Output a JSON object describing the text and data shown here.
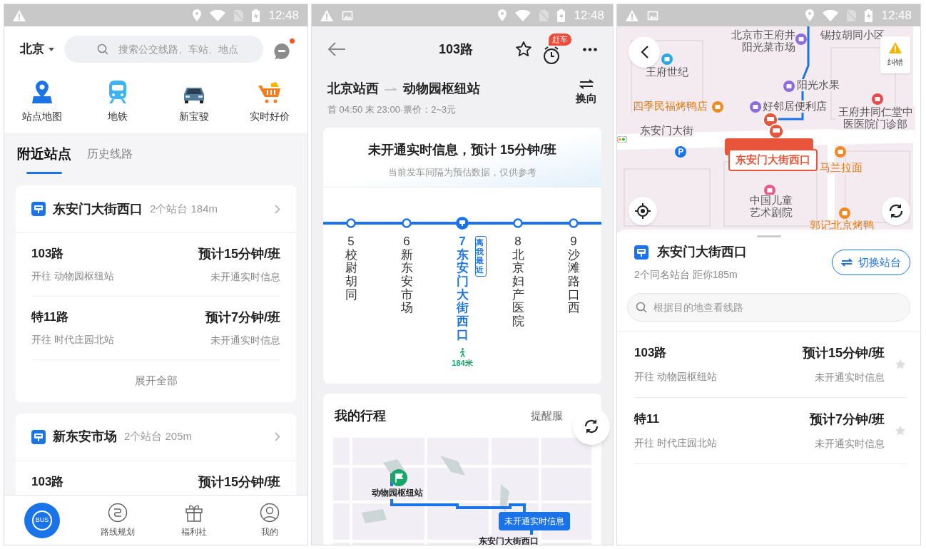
{
  "home_screen": {
    "status_bar": {
      "time": "12:48",
      "image_notice": false
    },
    "city": "北京",
    "search": {
      "placeholder": "搜索公交线路、车站、地点"
    },
    "messages_unread": true,
    "shortcuts": [
      {
        "label": "站点地图",
        "kind": "pin"
      },
      {
        "label": "地铁",
        "kind": "metro"
      },
      {
        "label": "新宝骏",
        "kind": "car"
      },
      {
        "label": "实时好价",
        "kind": "cart"
      }
    ],
    "tabs": [
      {
        "label": "附近站点",
        "selected": true
      },
      {
        "label": "历史线路",
        "selected": false
      }
    ],
    "stations": [
      {
        "name": "东安门大街西口",
        "info": "2个站台 184m",
        "lines": [
          {
            "name": "103路",
            "direction": "开往 动物园枢纽站",
            "eta": "预计15分钟/班",
            "status": "未开通实时信息"
          },
          {
            "name": "特11路",
            "direction": "开往 时代庄园北站",
            "eta": "预计7分钟/班",
            "status": "未开通实时信息"
          }
        ],
        "more": "展开全部"
      },
      {
        "name": "新东安市场",
        "info": "2个站台 205m",
        "lines": [
          {
            "name": "103路",
            "eta": "预计15分钟/班"
          }
        ]
      }
    ],
    "nav": [
      {
        "label": "BUS",
        "kind": "bus",
        "selected": true
      },
      {
        "label": "路线规划",
        "kind": "route",
        "selected": false
      },
      {
        "label": "福利社",
        "kind": "gift",
        "selected": false
      },
      {
        "label": "我的",
        "kind": "profile",
        "selected": false
      }
    ]
  },
  "line_screen": {
    "status_bar": {
      "time": "12:48",
      "image_notice": true
    },
    "title": "103路",
    "badge": "赶车",
    "from": "北京站西",
    "to": "动物园枢纽站",
    "schedule": "首 04:50 末 23:00·票价：2~3元",
    "reverse": "换向",
    "notice": {
      "title": "未开通实时信息，预计 15分钟/班",
      "subtitle": "当前发车间隔为预估数据，仅供参考"
    },
    "stops": [
      {
        "number": "5",
        "name": "校尉胡同",
        "selected": false
      },
      {
        "number": "6",
        "name": "新东安市场",
        "selected": false
      },
      {
        "number": "7",
        "name": "东安门大街西口",
        "selected": true,
        "tag": "离我最近",
        "walk": "184米"
      },
      {
        "number": "8",
        "name": "北京妇产医院",
        "selected": false
      },
      {
        "number": "9",
        "name": "沙滩路口西",
        "selected": false
      }
    ],
    "trip": {
      "title": "我的行程",
      "link": "提醒服",
      "map_labels": [
        {
          "text": "动物园枢纽站",
          "kind": "place"
        },
        {
          "text": "未开通实时信息",
          "kind": "bubble"
        },
        {
          "text": "东安门大街西口",
          "kind": "place"
        }
      ]
    }
  },
  "station_screen": {
    "status_bar": {
      "time": "12:48",
      "image_notice": true
    },
    "map": {
      "report": "纠错",
      "stop_label": "东安门大街西口",
      "labels": [
        {
          "text": "北京市王府井阳光菜市场",
          "kind": "market"
        },
        {
          "text": "锡拉胡同小区",
          "kind": "residential"
        },
        {
          "text": "王府世纪",
          "kind": "mall"
        },
        {
          "text": "阳光水果",
          "kind": "shop"
        },
        {
          "text": "四季民福烤鸭店",
          "kind": "restaurant"
        },
        {
          "text": "好邻居便利店",
          "kind": "shop"
        },
        {
          "text": "王府井同仁堂中医医院门诊部",
          "kind": "hospital"
        },
        {
          "text": "东安门大街",
          "kind": "street"
        },
        {
          "text": "马兰拉面",
          "kind": "restaurant"
        },
        {
          "text": "中国儿童艺术剧院",
          "kind": "theater"
        },
        {
          "text": "郭记北京烤鸭",
          "kind": "restaurant"
        }
      ]
    },
    "name": "东安门大街西口",
    "info": "2个同名站台 距你185m",
    "switch": "切换站台",
    "search": {
      "placeholder": "根据目的地查看线路"
    },
    "lines": [
      {
        "name": "103路",
        "direction": "开往 动物园枢纽站",
        "eta": "预计15分钟/班",
        "status": "未开通实时信息",
        "favorite": false
      },
      {
        "name": "特11",
        "direction": "开往 时代庄园北站",
        "eta": "预计7分钟/班",
        "status": "未开通实时信息",
        "favorite": false
      }
    ]
  }
}
